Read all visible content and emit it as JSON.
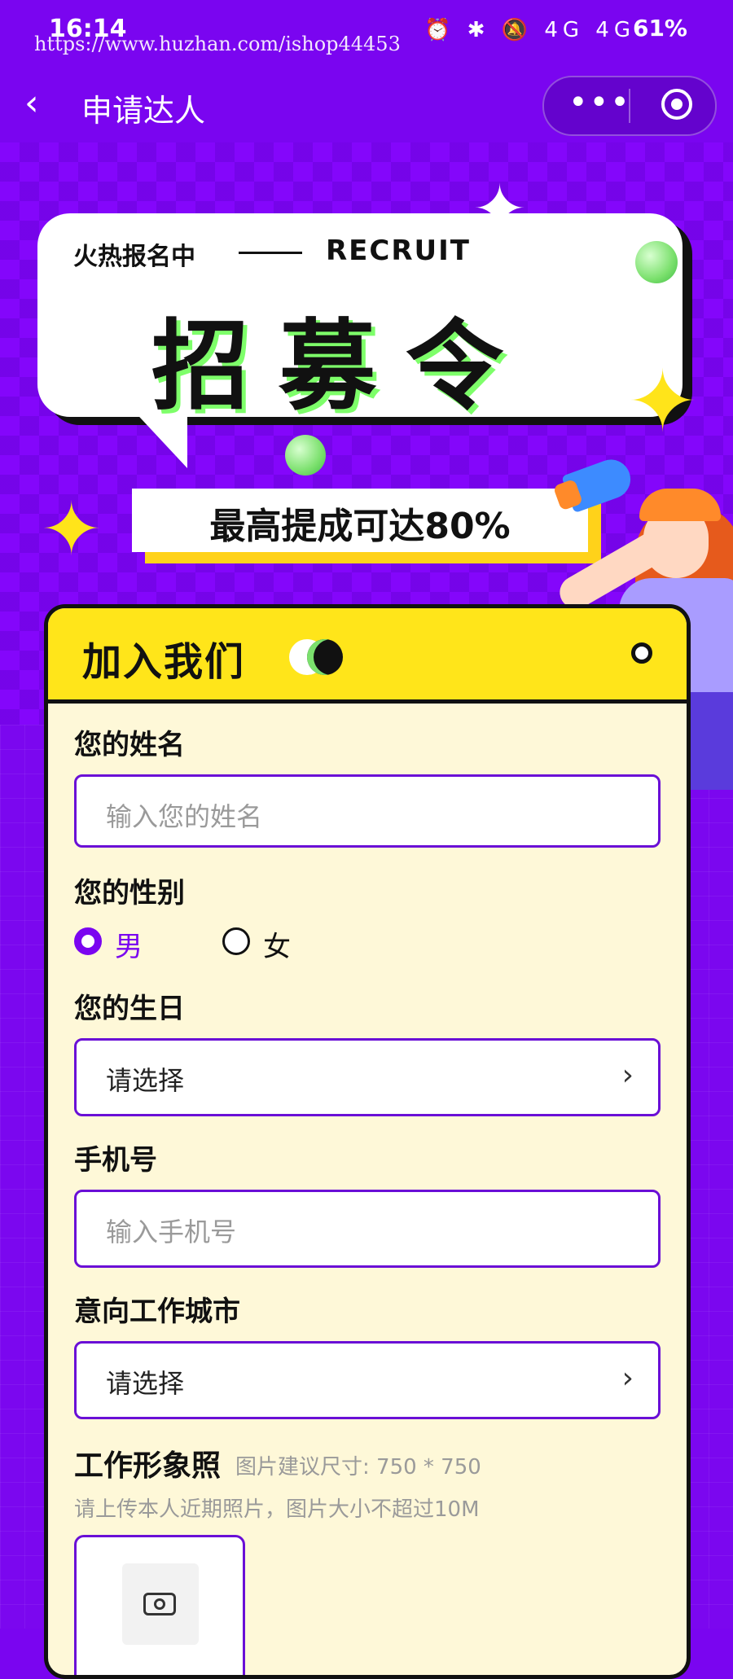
{
  "status_bar": {
    "time": "16:14",
    "watermark": "https://www.huzhan.com/ishop44453",
    "signal_icons": "⏰ ✱ 🔕 4G 4G",
    "battery": "61%"
  },
  "nav": {
    "title": "申请达人",
    "back_icon": "chevron-left",
    "more_icon": "•••"
  },
  "banner": {
    "tag": "火热报名中",
    "tag_en": "RECRUIT",
    "title": "招募令",
    "commission": "最高提成可达80%"
  },
  "form": {
    "header": "加入我们",
    "name_label": "您的姓名",
    "name_placeholder": "输入您的姓名",
    "gender_label": "您的性别",
    "gender_options": [
      {
        "label": "男",
        "selected": true
      },
      {
        "label": "女",
        "selected": false
      }
    ],
    "birthday_label": "您的生日",
    "birthday_value": "请选择",
    "phone_label": "手机号",
    "phone_placeholder": "输入手机号",
    "city_label": "意向工作城市",
    "city_value": "请选择",
    "photo_label": "工作形象照",
    "photo_size_hint": "图片建议尺寸: 750 * 750",
    "photo_desc": "请上传本人近期照片，图片大小不超过10M"
  },
  "colors": {
    "primary_purple": "#7a05f0",
    "banner_yellow": "#ffe51a",
    "accent_green": "#7be06d",
    "card_bg": "#fef8d8"
  }
}
